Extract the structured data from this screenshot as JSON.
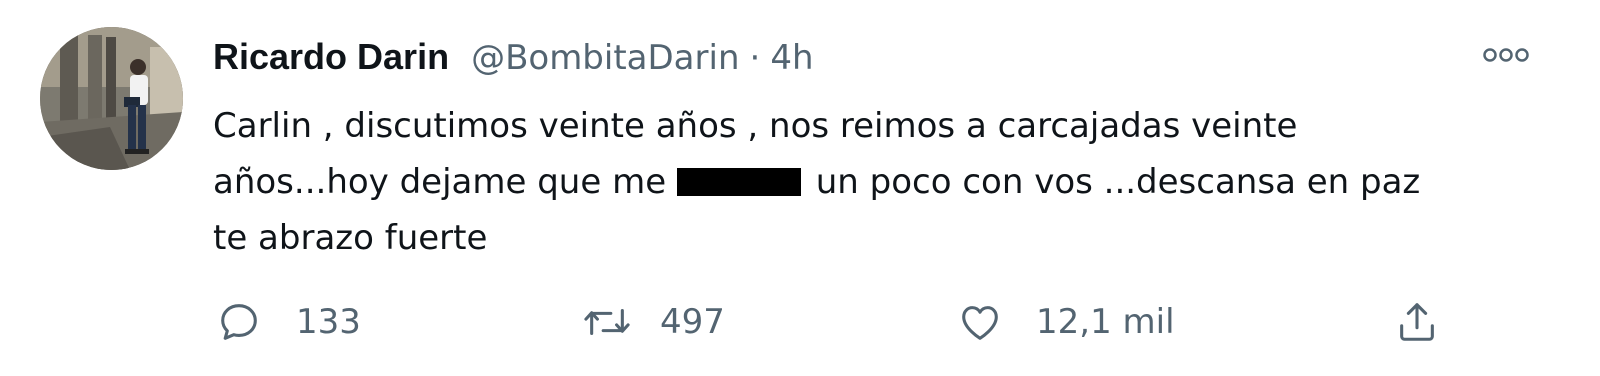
{
  "tweet": {
    "author": {
      "name": "Ricardo Darin",
      "handle": "@BombitaDarin"
    },
    "separator": "·",
    "time": "4h",
    "text_lines": [
      "Carlin , discutimos veinte años , nos reimos a carcajadas veinte",
      "años...hoy dejame que me",
      "un poco con vos ...descansa en paz",
      "te abrazo fuerte"
    ],
    "stats": {
      "replies": "133",
      "retweets": "497",
      "likes": "12,1 mil"
    }
  },
  "icons": {
    "more": "more-options-icon",
    "reply": "reply-icon",
    "retweet": "retweet-icon",
    "like": "heart-icon",
    "share": "share-icon"
  },
  "colors": {
    "text": "#0f1419",
    "secondary": "#536471"
  }
}
